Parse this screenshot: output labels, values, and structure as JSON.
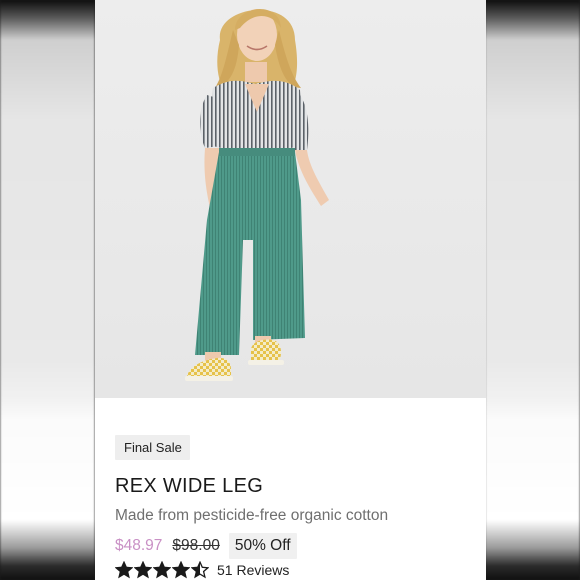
{
  "product": {
    "image_alt": "Woman wearing teal corduroy wide-leg pants, striped tied shirt and yellow checkered sneakers",
    "badge": "Final Sale",
    "title": "REX WIDE LEG",
    "subtitle": "Made from pesticide-free organic cotton",
    "sale_price": "$48.97",
    "original_price": "$98.00",
    "discount": "50% Off",
    "rating": 4.5,
    "rating_max": 5,
    "reviews": "51 Reviews"
  },
  "colors": {
    "sale_price": "#c990c5",
    "pants": "#4f9a8a",
    "shoes": "#d9b43a"
  }
}
